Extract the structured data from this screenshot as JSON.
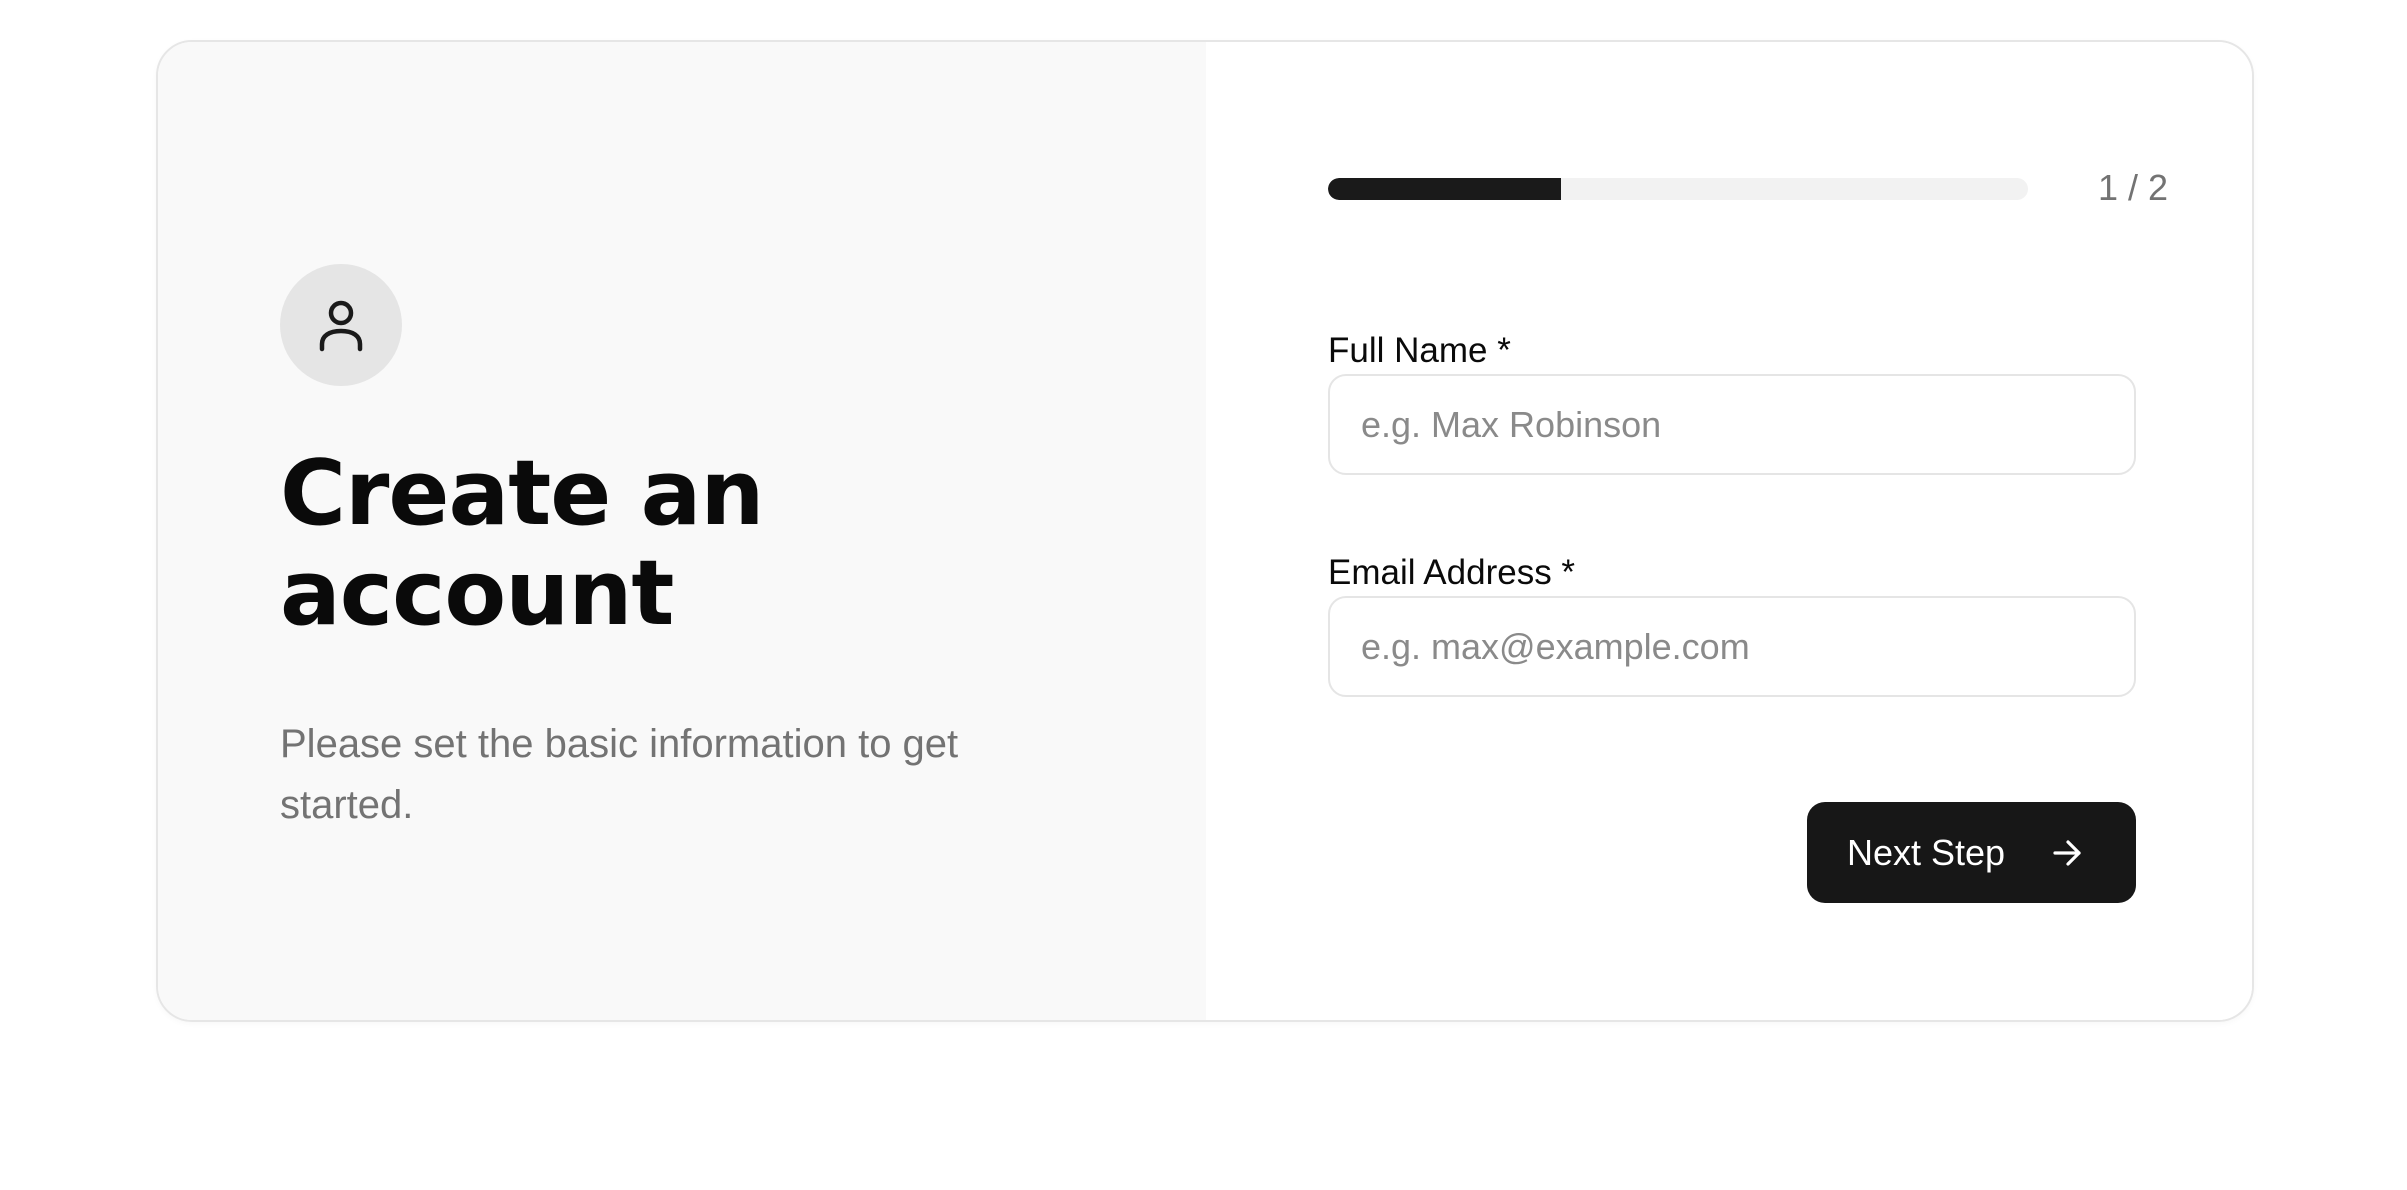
{
  "left": {
    "title": "Create an account",
    "subtitle": "Please set the basic information to get started.",
    "icon": "user-icon"
  },
  "progress": {
    "fraction": 0.333,
    "counter": "1 / 2",
    "fill_color": "#1a1a1a",
    "track_color": "#f2f2f2"
  },
  "form": {
    "full_name": {
      "label": "Full Name *",
      "placeholder": "e.g. Max Robinson",
      "value": ""
    },
    "email": {
      "label": "Email Address *",
      "placeholder": "e.g. max@example.com",
      "value": ""
    }
  },
  "actions": {
    "next_label": "Next Step",
    "next_icon": "arrow-right-icon",
    "button_color": "#171717"
  }
}
